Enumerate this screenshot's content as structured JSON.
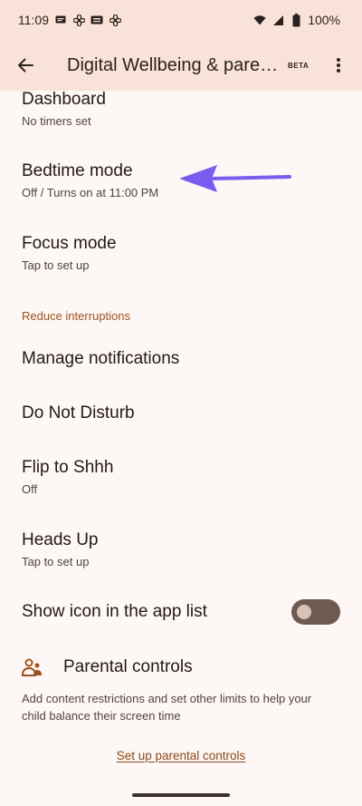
{
  "statusbar": {
    "time": "11:09",
    "battery": "100%"
  },
  "appbar": {
    "title": "Digital Wellbeing & parental controls",
    "badge": "BETA"
  },
  "items": {
    "dashboard": {
      "title": "Dashboard",
      "subtitle": "No timers set"
    },
    "bedtime": {
      "title": "Bedtime mode",
      "subtitle": "Off / Turns on at 11:00 PM"
    },
    "focus": {
      "title": "Focus mode",
      "subtitle": "Tap to set up"
    },
    "section": "Reduce interruptions",
    "notifications": {
      "title": "Manage notifications"
    },
    "dnd": {
      "title": "Do Not Disturb"
    },
    "flip": {
      "title": "Flip to Shhh",
      "subtitle": "Off"
    },
    "headsup": {
      "title": "Heads Up",
      "subtitle": "Tap to set up"
    },
    "showicon": {
      "title": "Show icon in the app list",
      "enabled": false
    }
  },
  "parental": {
    "title": "Parental controls",
    "description": "Add content restrictions and set other limits to help your child balance their screen time",
    "link": "Set up parental controls"
  },
  "colors": {
    "app_bar": "#f9e3d8",
    "background": "#fdf7f6",
    "accent": "#a0521d",
    "arrow": "#7a5cf0"
  }
}
